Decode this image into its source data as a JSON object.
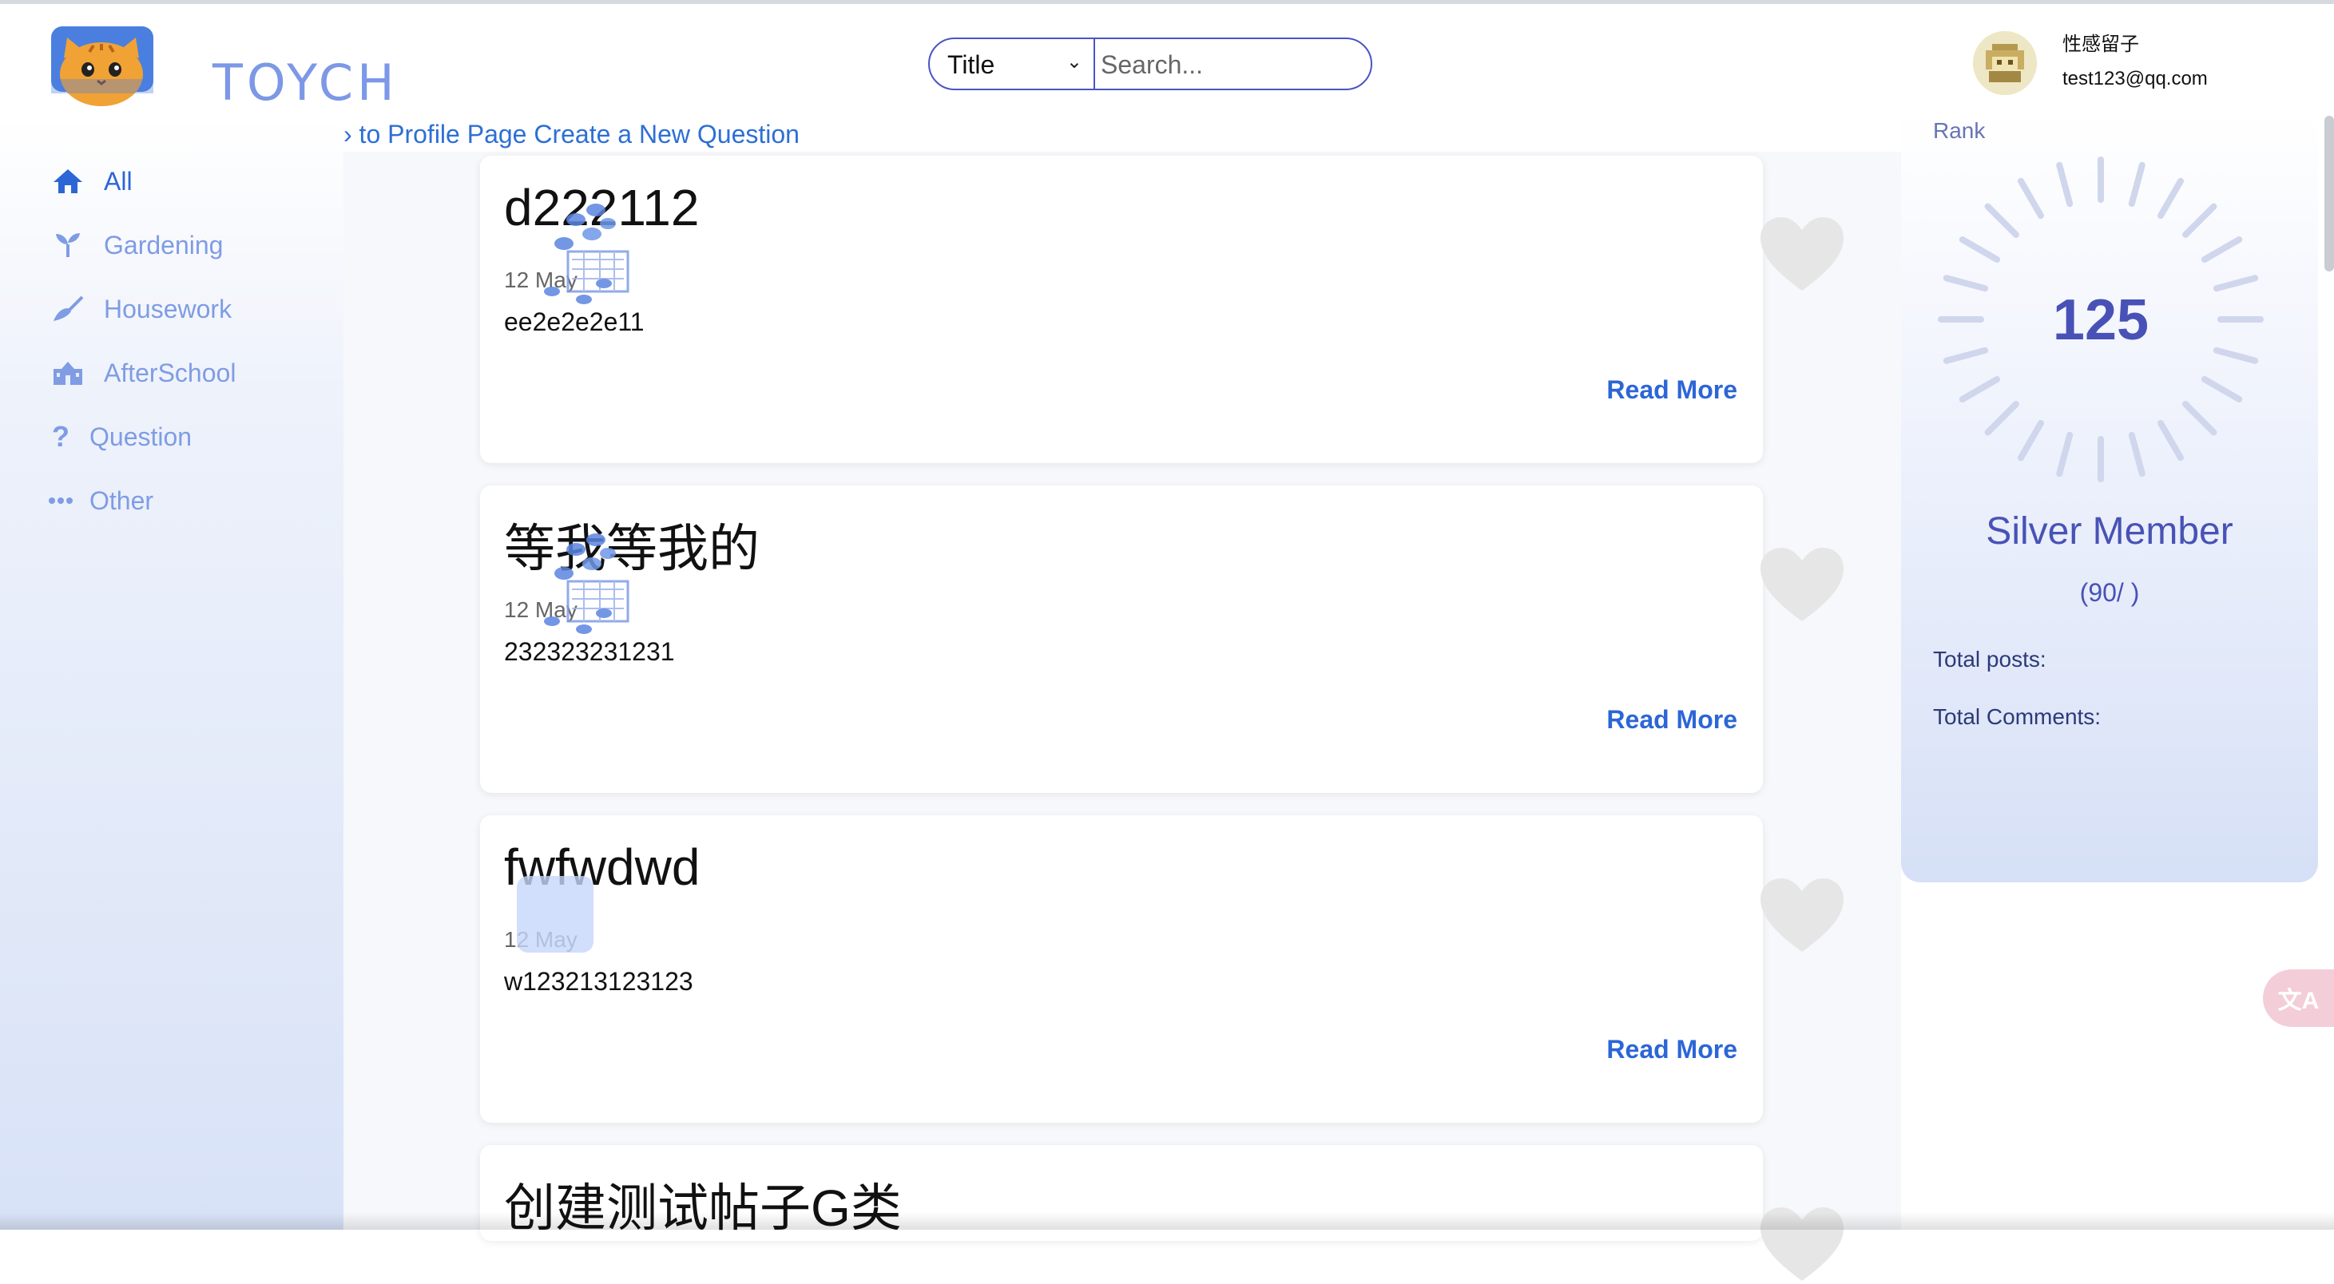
{
  "app": {
    "brand": "TOYCH"
  },
  "search": {
    "select_value": "Title",
    "placeholder": "Search..."
  },
  "user": {
    "name": "性感留子",
    "email": "test123@qq.com"
  },
  "sidebar": {
    "items": [
      {
        "label": "All",
        "icon": "home-icon",
        "active": true
      },
      {
        "label": "Gardening",
        "icon": "sprout-icon"
      },
      {
        "label": "Housework",
        "icon": "broom-icon"
      },
      {
        "label": "AfterSchool",
        "icon": "school-icon"
      },
      {
        "label": "Question",
        "icon": "question-icon"
      },
      {
        "label": "Other",
        "icon": "more-icon"
      }
    ]
  },
  "breadcrumb": {
    "profile": "› to Profile Page",
    "create": "Create a New Question"
  },
  "posts": [
    {
      "title": "d222112",
      "date": "12 May",
      "body": "ee2e2e2e11",
      "read_more": "Read More"
    },
    {
      "title": "等我等我的",
      "date": "12 May",
      "body": "232323231231",
      "read_more": "Read More"
    },
    {
      "title": "fwfwdwd",
      "date": "12 May",
      "body": "w123213123123",
      "read_more": "Read More"
    },
    {
      "title": "创建测试帖子G类",
      "date": "",
      "body": "",
      "read_more": ""
    }
  ],
  "rank": {
    "label": "Rank",
    "score": "125",
    "member": "Silver Member",
    "points": "(90/ )",
    "total_posts": "Total posts:",
    "total_comments": "Total Comments:"
  },
  "colors": {
    "accent": "#2c66d6",
    "rank": "#4852b6",
    "heart": "#e6e6e6"
  }
}
